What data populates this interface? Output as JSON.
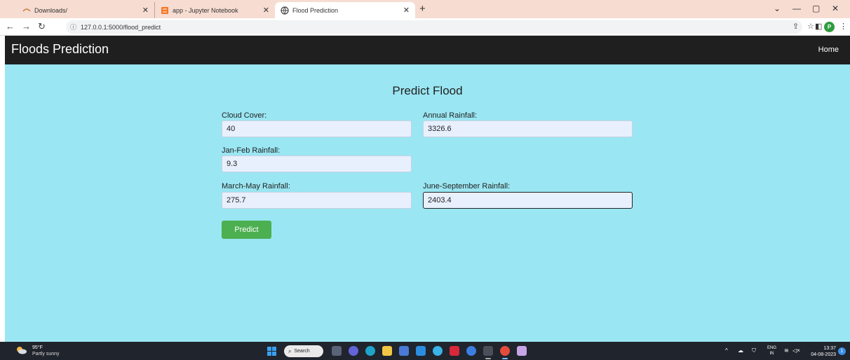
{
  "browser": {
    "tabs": [
      {
        "label": "Downloads/",
        "icon": "downloads-icon"
      },
      {
        "label": "app - Jupyter Notebook",
        "icon": "jupyter-icon"
      },
      {
        "label": "Flood Prediction",
        "icon": "globe-icon",
        "active": true
      }
    ],
    "new_tab": "+",
    "url": "127.0.0.1:5000/flood_predict",
    "profile_initial": "P"
  },
  "app": {
    "brand": "Floods Prediction",
    "nav_home": "Home",
    "form_title": "Predict Flood",
    "fields": {
      "cloud_cover": {
        "label": "Cloud Cover:",
        "value": "40"
      },
      "annual_rainfall": {
        "label": "Annual Rainfall:",
        "value": "3326.6"
      },
      "jan_feb_rainfall": {
        "label": "Jan-Feb Rainfall:",
        "value": "9.3"
      },
      "march_may_rainfall": {
        "label": "March-May Rainfall:",
        "value": "275.7"
      },
      "june_september_rainfall": {
        "label": "June-September Rainfall:",
        "value": "2403.4"
      }
    },
    "predict_button": "Predict",
    "colors": {
      "nav_bg": "#1f1f1f",
      "page_bg": "#9ae6f2",
      "button": "#4caf50",
      "input_bg": "#e8f0fe"
    }
  },
  "taskbar": {
    "weather_temp": "95°F",
    "weather_desc": "Partly sunny",
    "search_label": "Search",
    "lang_top": "ENG",
    "lang_bottom": "IN",
    "time": "13:37",
    "date": "04-08-2023",
    "notification_count": "1"
  }
}
